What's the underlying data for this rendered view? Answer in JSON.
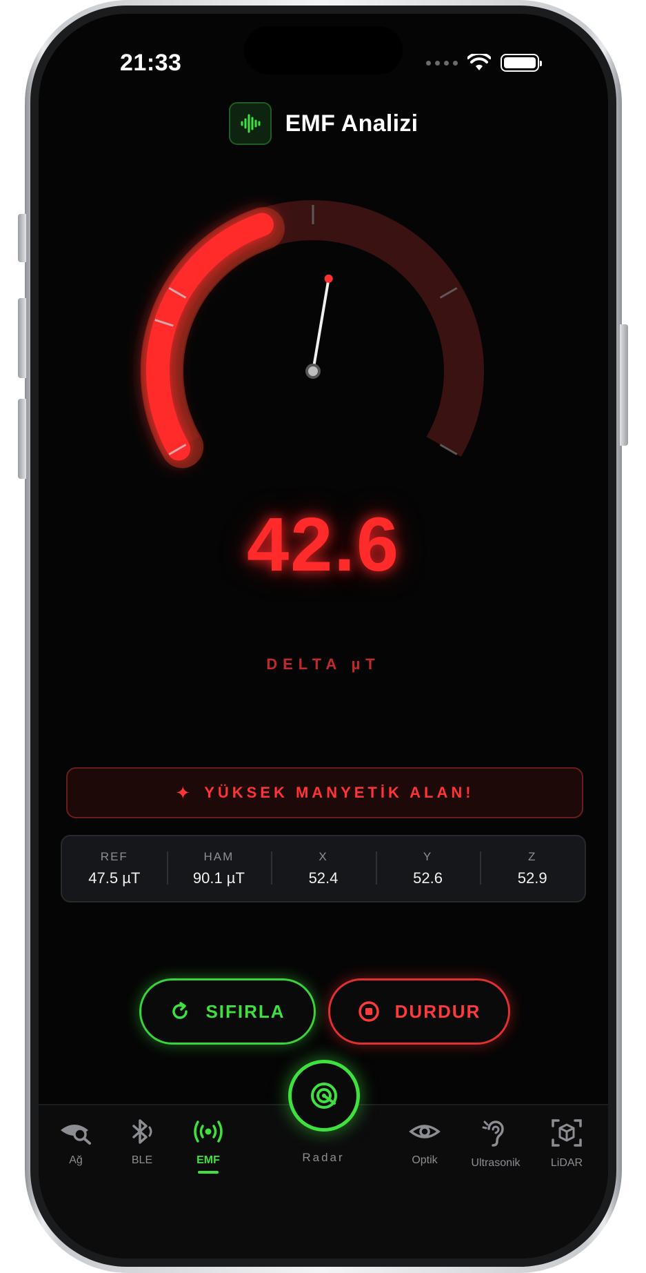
{
  "status": {
    "time": "21:33"
  },
  "header": {
    "title": "EMF Analizi"
  },
  "gauge": {
    "fraction": 0.42
  },
  "reading": {
    "value": "42.6",
    "unit": "DELTA  µT"
  },
  "alert": {
    "icon": "sparkle-icon",
    "text": "YÜKSEK MANYETİK ALAN!"
  },
  "stats": [
    {
      "label": "REF",
      "value": "47.5 µT"
    },
    {
      "label": "HAM",
      "value": "90.1 µT"
    },
    {
      "label": "X",
      "value": "52.4"
    },
    {
      "label": "Y",
      "value": "52.6"
    },
    {
      "label": "Z",
      "value": "52.9"
    }
  ],
  "buttons": {
    "reset_label": "SIFIRLA",
    "stop_label": "DURDUR"
  },
  "tabs": [
    {
      "label": "Ağ",
      "icon": "network-eye-icon"
    },
    {
      "label": "BLE",
      "icon": "bluetooth-icon"
    },
    {
      "label": "EMF",
      "icon": "broadcast-icon",
      "active": true
    },
    {
      "label": "Radar",
      "icon": "radar-icon"
    },
    {
      "label": "Optik",
      "icon": "eye-icon"
    },
    {
      "label": "Ultrasonik",
      "icon": "ear-icon"
    },
    {
      "label": "LiDAR",
      "icon": "cube-scan-icon"
    }
  ],
  "colors": {
    "accent_green": "#3fe13f",
    "alert_red": "#ff2b2b",
    "background": "#050505"
  }
}
